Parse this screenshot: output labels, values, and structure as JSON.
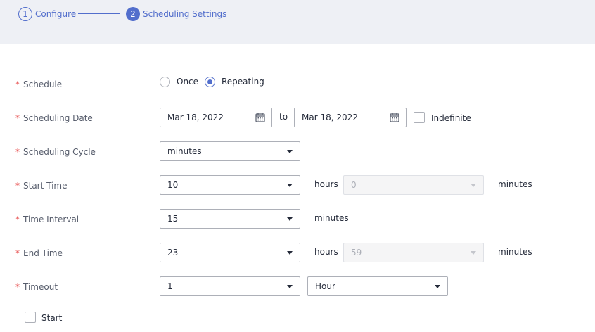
{
  "steps": [
    {
      "number": "1",
      "label": "Configure"
    },
    {
      "number": "2",
      "label": "Scheduling Settings"
    }
  ],
  "required_mark": "*",
  "form": {
    "schedule": {
      "label": "Schedule",
      "options": [
        "Once",
        "Repeating"
      ],
      "selected": "Repeating"
    },
    "scheduling_date": {
      "label": "Scheduling Date",
      "start": "Mar 18, 2022",
      "separator": "to",
      "end": "Mar 18, 2022",
      "indefinite_label": "Indefinite",
      "indefinite_checked": false,
      "icon": "calendar-icon"
    },
    "scheduling_cycle": {
      "label": "Scheduling Cycle",
      "value": "minutes"
    },
    "start_time": {
      "label": "Start Time",
      "hours_value": "10",
      "hours_unit": "hours",
      "minutes_value": "0",
      "minutes_unit": "minutes",
      "minutes_disabled": true
    },
    "time_interval": {
      "label": "Time Interval",
      "value": "15",
      "unit": "minutes"
    },
    "end_time": {
      "label": "End Time",
      "hours_value": "23",
      "hours_unit": "hours",
      "minutes_value": "59",
      "minutes_unit": "minutes",
      "minutes_disabled": true
    },
    "timeout": {
      "label": "Timeout",
      "value": "1",
      "unit": "Hour"
    },
    "start_checkbox": {
      "label": "Start",
      "checked": false
    }
  },
  "colors": {
    "accent": "#526ecc",
    "required": "#e74c4c",
    "stepbar_bg": "#eef0f5"
  }
}
